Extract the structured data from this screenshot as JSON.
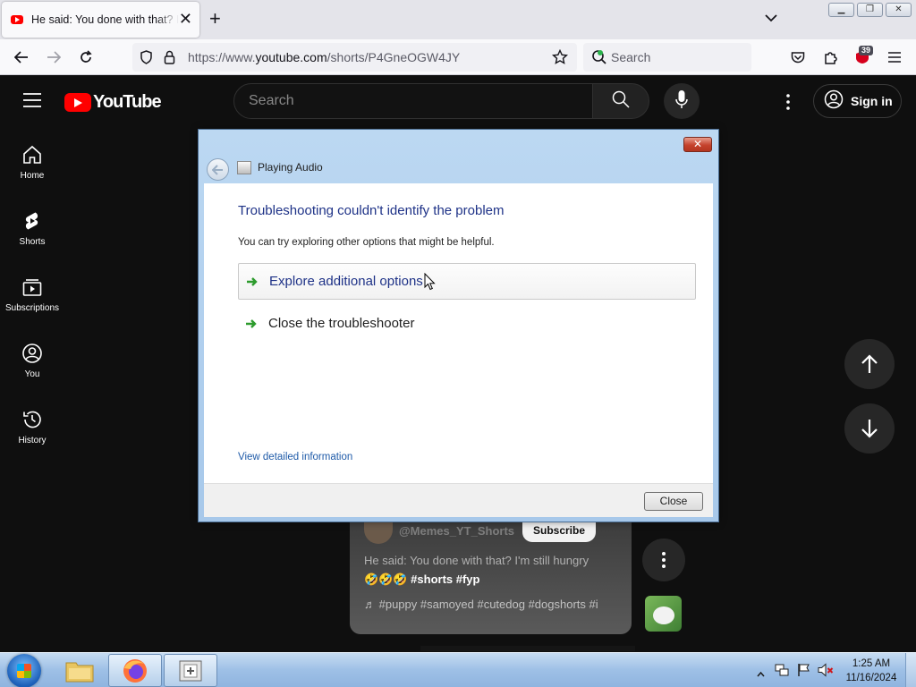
{
  "browser": {
    "tab_title": "He said: You done with that? I'm still hungry",
    "url_prefix": "https://www.",
    "url_domain": "youtube.com",
    "url_path": "/shorts/P4GneOGW4JY",
    "search_placeholder": "Search",
    "extensions_badge": "39"
  },
  "youtube": {
    "logo_text": "YouTube",
    "search_placeholder": "Search",
    "sign_in_label": "Sign in",
    "sidebar": [
      {
        "label": "Home",
        "icon": "home-icon"
      },
      {
        "label": "Shorts",
        "icon": "shorts-icon"
      },
      {
        "label": "Subscriptions",
        "icon": "subscriptions-icon"
      },
      {
        "label": "You",
        "icon": "you-icon"
      },
      {
        "label": "History",
        "icon": "history-icon"
      }
    ],
    "short": {
      "channel": "@Memes_YT_Shorts",
      "subscribe_label": "Subscribe",
      "title": "He said: You done with that? I'm still hungry",
      "tags_line": "🤣🤣🤣 #shorts #fyp",
      "music_line": "♬ #puppy #samoyed #cutedog #dogshorts #i"
    }
  },
  "dialog": {
    "window_title": "Playing Audio",
    "heading": "Troubleshooting couldn't identify the problem",
    "subtext": "You can try exploring other options that might be helpful.",
    "options": [
      {
        "label": "Explore additional options"
      },
      {
        "label": "Close the troubleshooter"
      }
    ],
    "details_link": "View detailed information",
    "close_button": "Close",
    "heading_color": "#1e3287",
    "link_color": "#1e5aa8"
  },
  "taskbar": {
    "time": "1:25 AM",
    "date": "11/16/2024"
  },
  "colors": {
    "youtube_red": "#ff0000",
    "page_bg": "#0f0f0f",
    "arrow_green": "#2d9b2d"
  }
}
